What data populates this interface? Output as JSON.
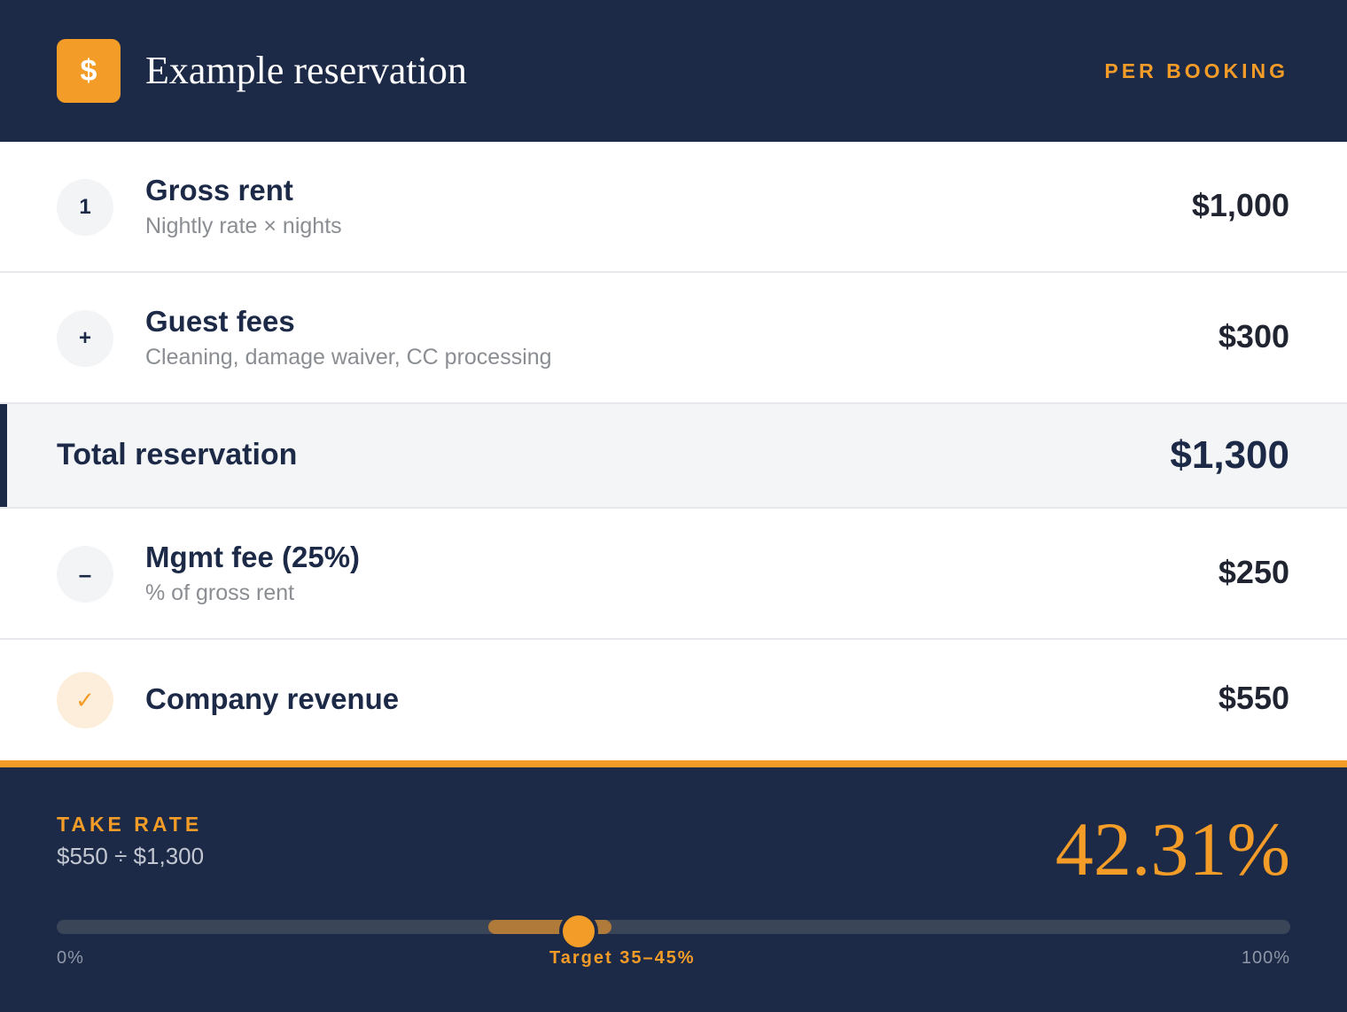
{
  "header": {
    "logo_symbol": "$",
    "title": "Example reservation",
    "tag": "PER BOOKING",
    "accent_color": "#f39c28",
    "background_color": "#1c2a47"
  },
  "rows": [
    {
      "badge": "1",
      "label": "Gross rent",
      "sub": "Nightly rate × nights",
      "amount": "$1,000"
    },
    {
      "badge": "+",
      "label": "Guest fees",
      "sub": "Cleaning, damage waiver, CC processing",
      "amount": "$300"
    }
  ],
  "total": {
    "label": "Total reservation",
    "amount": "$1,300"
  },
  "deductions": [
    {
      "badge": "–",
      "label": "Mgmt fee (25%)",
      "sub": "% of gross rent",
      "amount": "$250"
    }
  ],
  "result": {
    "badge": "✓",
    "label": "Company revenue",
    "amount": "$550"
  },
  "footer": {
    "label": "TAKE RATE",
    "formula": "$550 ÷ $1,300",
    "rate": "42.31%",
    "rate_value_percent": 42.31,
    "target_range_percent": [
      35,
      45
    ],
    "scale_min": "0%",
    "scale_target": "Target 35–45%",
    "scale_max": "100%"
  }
}
